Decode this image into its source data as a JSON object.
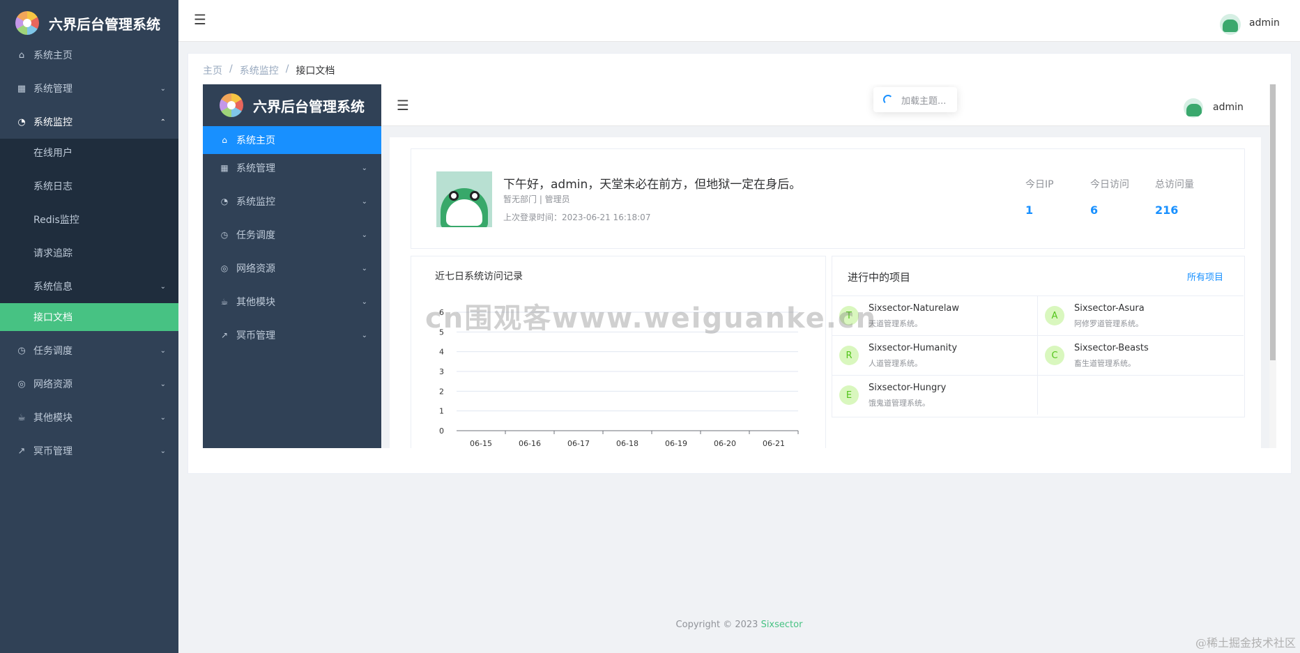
{
  "app": {
    "title": "六界后台管理系统",
    "user": "admin"
  },
  "sidebar": {
    "items": [
      {
        "label": "系统主页",
        "icon": "home-icon"
      },
      {
        "label": "系统管理",
        "icon": "grid-icon"
      },
      {
        "label": "系统监控",
        "icon": "dashboard-icon"
      },
      {
        "label": "任务调度",
        "icon": "clock-icon"
      },
      {
        "label": "网络资源",
        "icon": "compass-icon"
      },
      {
        "label": "其他模块",
        "icon": "cup-icon"
      },
      {
        "label": "冥币管理",
        "icon": "trend-icon"
      }
    ],
    "sub_items": [
      "在线用户",
      "系统日志",
      "Redis监控",
      "请求追踪",
      "系统信息",
      "接口文档"
    ]
  },
  "breadcrumb": [
    "主页",
    "系统监控",
    "接口文档"
  ],
  "inner": {
    "loading_text": "加载主题...",
    "greeting": "下午好，admin，天堂未必在前方，但地狱一定在身后。",
    "dept": "暂无部门 | 管理员",
    "last_login": "上次登录时间：2023-06-21 16:18:07",
    "stats": [
      {
        "label": "今日IP",
        "value": "1"
      },
      {
        "label": "今日访问",
        "value": "6"
      },
      {
        "label": "总访问量",
        "value": "216"
      }
    ],
    "chart_title": "近七日系统访问记录",
    "projects_title": "进行中的项目",
    "projects_link": "所有项目",
    "projects": [
      {
        "letter": "T",
        "name": "Sixsector-Naturelaw",
        "desc": "天道管理系统。"
      },
      {
        "letter": "A",
        "name": "Sixsector-Asura",
        "desc": "阿修罗道管理系统。"
      },
      {
        "letter": "R",
        "name": "Sixsector-Humanity",
        "desc": "人道管理系统。"
      },
      {
        "letter": "C",
        "name": "Sixsector-Beasts",
        "desc": "畜生道管理系统。"
      },
      {
        "letter": "E",
        "name": "Sixsector-Hungry",
        "desc": "饿鬼道管理系统。"
      }
    ]
  },
  "chart_data": {
    "type": "bar",
    "categories": [
      "06-15",
      "06-16",
      "06-17",
      "06-18",
      "06-19",
      "06-20",
      "06-21"
    ],
    "values": [
      0,
      0,
      0,
      0,
      0,
      0,
      0
    ],
    "y_ticks": [
      "0",
      "1",
      "2",
      "3",
      "4",
      "5",
      "6"
    ],
    "ylim": [
      0,
      6
    ],
    "title": "近七日系统访问记录",
    "grid": true
  },
  "footer": {
    "text": "Copyright © 2023 ",
    "brand": "Sixsector"
  },
  "watermark": "cn围观客www.weiguanke.cn",
  "corner_mark": "@稀土掘金技术社区"
}
